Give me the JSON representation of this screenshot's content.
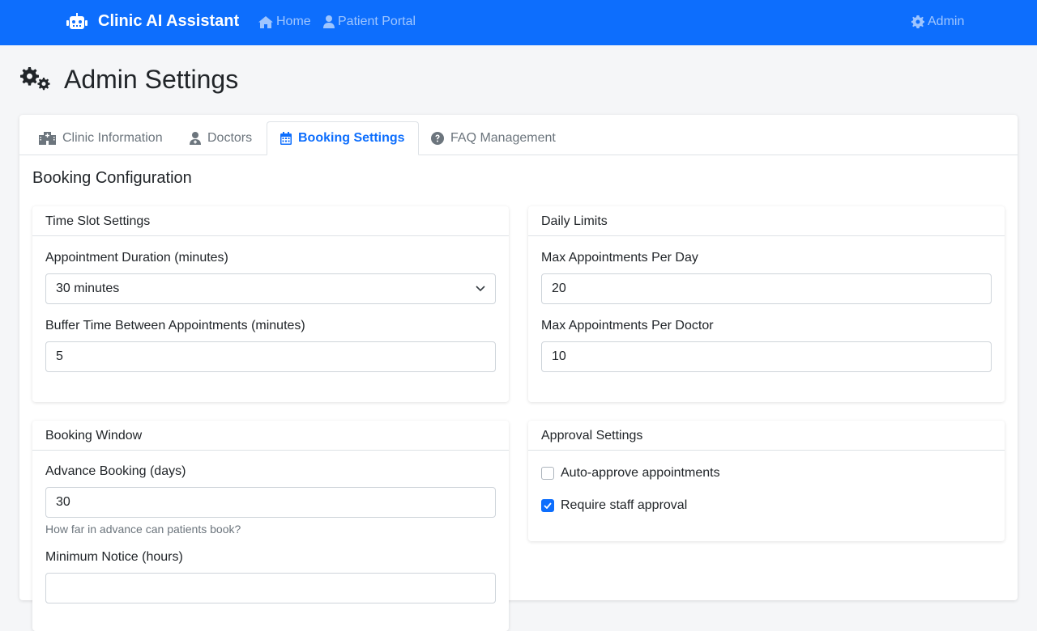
{
  "navbar": {
    "brand": "Clinic AI Assistant",
    "links": {
      "home": "Home",
      "portal": "Patient Portal",
      "admin": "Admin"
    }
  },
  "page": {
    "title": "Admin Settings"
  },
  "tabs": {
    "clinic": "Clinic Information",
    "doctors": "Doctors",
    "booking": "Booking Settings",
    "faq": "FAQ Management",
    "active": "Booking Settings"
  },
  "booking": {
    "section_title": "Booking Configuration",
    "time_slot": {
      "header": "Time Slot Settings",
      "duration_label": "Appointment Duration (minutes)",
      "duration_value": "30 minutes",
      "buffer_label": "Buffer Time Between Appointments (minutes)",
      "buffer_value": "5"
    },
    "daily_limits": {
      "header": "Daily Limits",
      "per_day_label": "Max Appointments Per Day",
      "per_day_value": "20",
      "per_doctor_label": "Max Appointments Per Doctor",
      "per_doctor_value": "10"
    },
    "booking_window": {
      "header": "Booking Window",
      "advance_label": "Advance Booking (days)",
      "advance_value": "30",
      "advance_help": "How far in advance can patients book?",
      "notice_label": "Minimum Notice (hours)"
    },
    "approval": {
      "header": "Approval Settings",
      "auto_label": "Auto-approve appointments",
      "auto_checked": false,
      "staff_label": "Require staff approval",
      "staff_checked": true
    }
  },
  "colors": {
    "primary": "#0d6efd",
    "background": "#f5f6f8"
  }
}
